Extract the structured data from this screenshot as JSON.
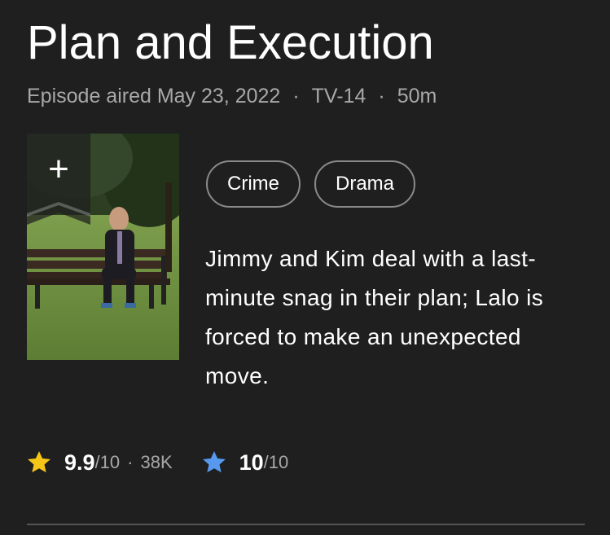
{
  "episode": {
    "title": "Plan and Execution",
    "aired": "Episode aired May 23, 2022",
    "certificate": "TV-14",
    "runtime": "50m",
    "separator": "·"
  },
  "watchlist": {
    "icon": "plus-icon",
    "glyph": "+"
  },
  "genres": [
    "Crime",
    "Drama"
  ],
  "plot": "Jimmy and Kim deal with a last-minute snag in their plan; Lalo is forced to make an unexpected move.",
  "imdb_rating": {
    "icon": "star-icon",
    "color": "#f5c518",
    "value": "9.9",
    "max": "/10",
    "separator": "·",
    "votes": "38K"
  },
  "user_rating": {
    "icon": "star-icon",
    "color": "#5799ef",
    "value": "10",
    "max": "/10"
  }
}
